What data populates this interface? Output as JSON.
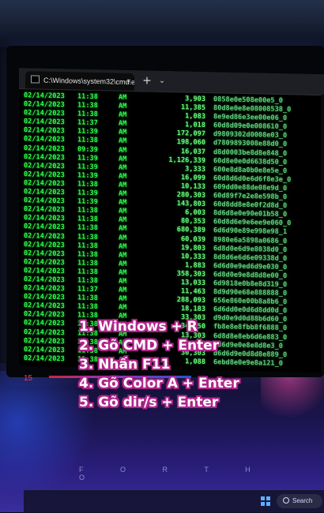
{
  "window": {
    "tab_title": "C:\\Windows\\system32\\cmd.e",
    "tab_close": "×",
    "new_tab": "+",
    "dropdown": "⌄"
  },
  "listing": [
    {
      "date": "02/14/2023",
      "time": "11:38",
      "ampm": "AM",
      "size": "3,903",
      "name": "0858e0e508e00e5_0"
    },
    {
      "date": "02/14/2023",
      "time": "11:38",
      "ampm": "AM",
      "size": "11,385",
      "name": "80d8e0e8e08008538_0"
    },
    {
      "date": "02/14/2023",
      "time": "11:38",
      "ampm": "AM",
      "size": "1,083",
      "name": "8e9ed86e3ee00e06_0"
    },
    {
      "date": "02/14/2023",
      "time": "11:37",
      "ampm": "AM",
      "size": "1,018",
      "name": "60d8d09e0e008610_0"
    },
    {
      "date": "02/14/2023",
      "time": "11:39",
      "ampm": "AM",
      "size": "172,097",
      "name": "d9809302d0008e03_0"
    },
    {
      "date": "02/14/2023",
      "time": "11:38",
      "ampm": "AM",
      "size": "198,060",
      "name": "d7809893008e88d0_0"
    },
    {
      "date": "02/14/2023",
      "time": "09:39",
      "ampm": "AM",
      "size": "16,037",
      "name": "d8d0003be8d8e848_0"
    },
    {
      "date": "02/14/2023",
      "time": "11:39",
      "ampm": "AM",
      "size": "1,126,339",
      "name": "60d8e0e0d6638d50_0"
    },
    {
      "date": "02/14/2023",
      "time": "11:39",
      "ampm": "AM",
      "size": "3,333",
      "name": "600e8d8a0b0e8e5e_0"
    },
    {
      "date": "02/14/2023",
      "time": "11:39",
      "ampm": "AM",
      "size": "16,099",
      "name": "60d8d6d0e6d6f8e3e_0"
    },
    {
      "date": "02/14/2023",
      "time": "11:38",
      "ampm": "AM",
      "size": "10,133",
      "name": "609dd0e88de08e9d_0"
    },
    {
      "date": "02/14/2023",
      "time": "11:39",
      "ampm": "AM",
      "size": "280,303",
      "name": "60d89f7e2e8e598b_0"
    },
    {
      "date": "02/14/2023",
      "time": "11:39",
      "ampm": "AM",
      "size": "143,803",
      "name": "60d8dd8e8e0f2d8d_0"
    },
    {
      "date": "02/14/2023",
      "time": "11:38",
      "ampm": "AM",
      "size": "6,003",
      "name": "8d6d8e0e90e01b58_0"
    },
    {
      "date": "02/14/2023",
      "time": "11:38",
      "ampm": "AM",
      "size": "80,353",
      "name": "60d8d6e9e6ee9e060_0"
    },
    {
      "date": "02/14/2023",
      "time": "11:38",
      "ampm": "AM",
      "size": "680,389",
      "name": "6d6d90e89e998e98_1"
    },
    {
      "date": "02/14/2023",
      "time": "11:38",
      "ampm": "AM",
      "size": "60,039",
      "name": "8980e6a5898a0686_0"
    },
    {
      "date": "02/14/2023",
      "time": "11:38",
      "ampm": "AM",
      "size": "19,803",
      "name": "6d8d0e6d9e8038d0_0"
    },
    {
      "date": "02/14/2023",
      "time": "11:38",
      "ampm": "AM",
      "size": "10,333",
      "name": "8d8d6e6d6e09338d_0"
    },
    {
      "date": "02/14/2023",
      "time": "11:38",
      "ampm": "AM",
      "size": "1,883",
      "name": "6d6d0e9ed6d9e030_0"
    },
    {
      "date": "02/14/2023",
      "time": "11:38",
      "ampm": "AM",
      "size": "358,303",
      "name": "6d8d0e9e8d8d8e00_0"
    },
    {
      "date": "02/14/2023",
      "time": "11:38",
      "ampm": "AM",
      "size": "13,033",
      "name": "6d9818e0b8e8d319_0"
    },
    {
      "date": "02/14/2023",
      "time": "11:37",
      "ampm": "AM",
      "size": "11,463",
      "name": "8d9d90e68e888888_0"
    },
    {
      "date": "02/14/2023",
      "time": "11:38",
      "ampm": "AM",
      "size": "288,093",
      "name": "656e860e00b8a8b6_0"
    },
    {
      "date": "02/14/2023",
      "time": "11:38",
      "ampm": "AM",
      "size": "18,183",
      "name": "6d6dd0e0d6d8dd0d_0"
    },
    {
      "date": "02/14/2023",
      "time": "11:38",
      "ampm": "AM",
      "size": "33,303",
      "name": "d9d0e9d0d88b6d60_0"
    },
    {
      "date": "02/14/2023",
      "time": "11:38",
      "ampm": "AM",
      "size": "34,350",
      "name": "fb8e8e8fbb8f6888_0"
    },
    {
      "date": "02/14/2023",
      "time": "11:38",
      "ampm": "AM",
      "size": "13,303",
      "name": "6d8d8e8eb6d6e883_0"
    },
    {
      "date": "02/14/2023",
      "time": "11:38",
      "ampm": "AM",
      "size": "8,003",
      "name": "6d6d9e0e8e8d8e3_0"
    },
    {
      "date": "02/14/2023",
      "time": "11:38",
      "ampm": "AM",
      "size": "30,303",
      "name": "d6d6d9e0d8d8e889_0"
    },
    {
      "date": "02/14/2023",
      "time": "11:38",
      "ampm": "AM",
      "size": "1,088",
      "name": "6ebd8e0e9e8a121_0"
    }
  ],
  "steps": [
    "1. Windows + R",
    "2. Gõ CMD + Enter",
    "3. Nhấn F11",
    "4. Gõ Color A + Enter",
    "5. Gõ dir/s + Enter"
  ],
  "background": {
    "red_label": "15",
    "wall_text": "F O R T H O",
    "search_label": "Search"
  },
  "colors": {
    "terminal_text": "#2bff4a",
    "step_outline": "#b1268c",
    "step_text": "#ffffff"
  }
}
